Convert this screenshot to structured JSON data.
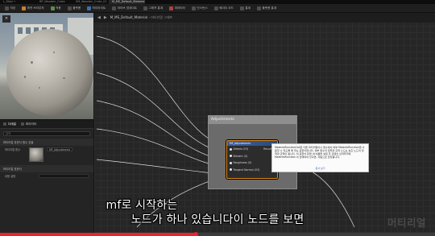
{
  "tabs": [
    {
      "label": "L_Main •"
    },
    {
      "label": "BP_Wooden_Crate"
    },
    {
      "label": "SM_Wooden_Crate_01"
    },
    {
      "label": "M_MS_Default_Material"
    }
  ],
  "toolbar": [
    {
      "label": "저장",
      "icon": "save-icon"
    },
    {
      "label": "에셋 브라우저",
      "icon": "folder-icon"
    },
    {
      "label": "적용",
      "icon": "apply-icon"
    },
    {
      "label": "플랫폼",
      "icon": "platform-icon"
    },
    {
      "label": "하이라이트",
      "icon": "highlight-icon"
    },
    {
      "label": "라이브 업데이트",
      "icon": "live-update-icon"
    },
    {
      "label": "그래프 통계",
      "icon": "stats-icon"
    },
    {
      "label": "파라미터",
      "icon": "parameter-icon"
    },
    {
      "label": "인스턴스",
      "icon": "instance-icon"
    },
    {
      "label": "쉐이더 코드",
      "icon": "shader-icon"
    },
    {
      "label": "통계",
      "icon": "chart-icon"
    },
    {
      "label": "플랫폼 통계",
      "icon": "platform-stats-icon"
    }
  ],
  "viewport": {
    "close_label": "×"
  },
  "details": {
    "tabs": [
      {
        "label": "디테일"
      },
      {
        "label": "파라미터"
      }
    ],
    "search_placeholder": "검색",
    "section_material": "머티리얼 표현식 함수 호출",
    "function_label": "머티리얼 함수",
    "function_value": "MF_Adjustments",
    "section_expression": "머티리얼 표현식",
    "desc_label": "내용 설명"
  },
  "graph": {
    "back": "◀",
    "forward": "▶",
    "title": "M_MS_Default_Material",
    "separator": "›",
    "subtitle": "머티리얼 그래프"
  },
  "comment": {
    "title": "Adjustments"
  },
  "node": {
    "title": "MF_Adjustments",
    "pins": [
      {
        "label": "Albedo (V3)",
        "out": "Result"
      },
      {
        "label": "Metallic (S)",
        "out": ""
      },
      {
        "label": "Roughness (S)",
        "out": ""
      },
      {
        "label": "Tangent Normal (V3)",
        "out": ""
      }
    ]
  },
  "tooltip": {
    "text": "MaterialFunctionCall은 다른 머티리얼이나 함수에서 외부 MaterialFunction을 사용할 수 있도록 해 주는 표현식입니다. 외부 함수의 입력과 출력 노드는 호출 노드의 입력과 출력이 됩니다. 이 표현식 유형 내 이름을 설정 후 콘텐츠 브라우저에 MaterialFunction 이 선택되어 있다면, 자동으로 할당됩니다.",
    "link": "문서 보기"
  },
  "subtitles": {
    "line1": "mf로 시작하는",
    "line2": "노드가 하나 있습니다이 노드를 보면"
  },
  "watermark": "머티리얼",
  "video": {
    "progress": 0.45
  }
}
